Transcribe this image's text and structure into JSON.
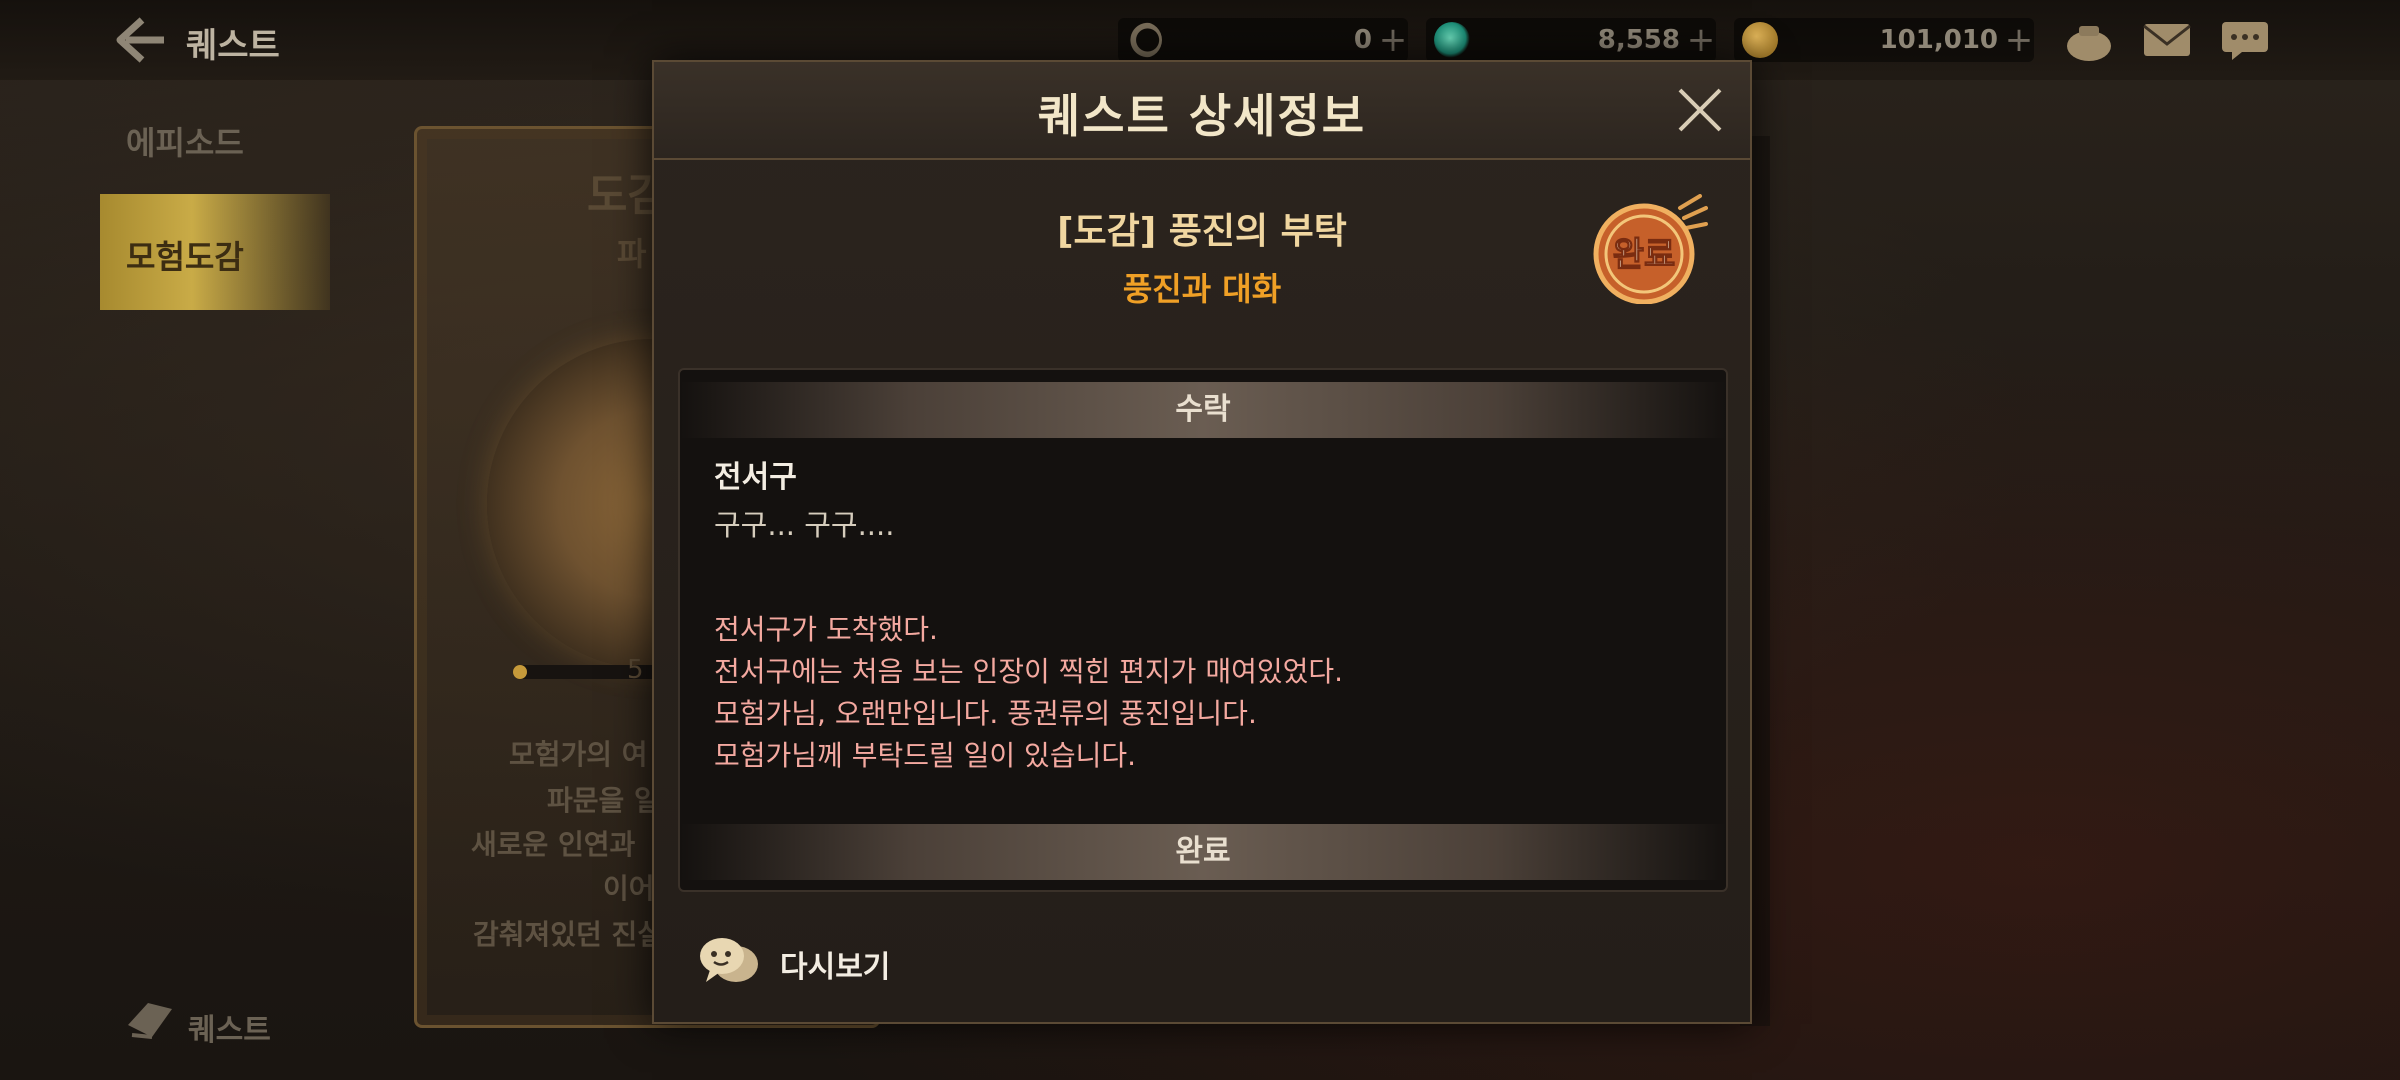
{
  "topbar": {
    "title": "퀘스트",
    "currencies": [
      {
        "icon": "moon-coin-icon",
        "value": "0"
      },
      {
        "icon": "green-gem-icon",
        "value": "8,558"
      },
      {
        "icon": "gold-coin-icon",
        "value": "101,010"
      }
    ],
    "plus_symbol": "+",
    "icons": [
      "pouch-icon",
      "mail-icon",
      "chat-icon"
    ]
  },
  "sidebar": {
    "items": [
      {
        "label": "에피소드",
        "active": false
      },
      {
        "label": "모험도감",
        "active": true
      }
    ],
    "bottom_label": "퀘스트"
  },
  "background_card": {
    "title": "도감",
    "subtitle": "파",
    "progress_fraction": 0.05,
    "progress_text": "5",
    "lines": [
      "모험가의 여",
      "파문을 일",
      "새로운 인연과",
      "이어",
      "감춰져있던 진실"
    ]
  },
  "dialog": {
    "title": "퀘스트 상세정보",
    "quest_name": "[도감] 풍진의 부탁",
    "quest_objective": "풍진과 대화",
    "stamp_text": "완료",
    "accept_header": "수락",
    "speaker": "전서구",
    "speaker_line": "구구... 구구....",
    "messages": [
      "전서구가 도착했다.",
      "전서구에는 처음 보는 인장이 찍힌 편지가 매여있었다.",
      "모험가님, 오랜만입니다. 풍권류의 풍진입니다.",
      "모험가님께 부탁드릴 일이 있습니다."
    ],
    "complete_header": "완료",
    "replay_label": "다시보기"
  },
  "colors": {
    "accent_gold": "#f0d6a0",
    "objective_orange": "#f0a026",
    "message_pink": "#f4a9a0"
  }
}
